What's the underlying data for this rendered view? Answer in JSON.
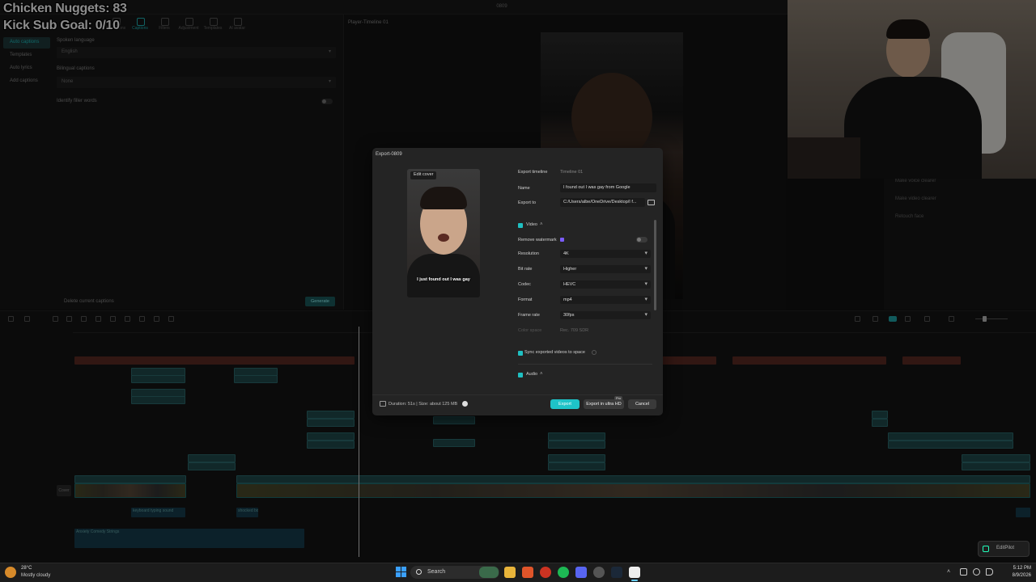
{
  "app": {
    "window_title": "0809"
  },
  "stream_overlay": {
    "line1": "Chicken Nuggets: 83",
    "line2": "Kick Sub Goal: 0/10"
  },
  "left_panel": {
    "toolbar_tabs": [
      "Transitions",
      "Captions",
      "Filters",
      "Adjustment",
      "Templates",
      "AI avatar"
    ],
    "side_menu": [
      "Auto captions",
      "Templates",
      "Auto lyrics",
      "Add captions"
    ],
    "spoken_language_label": "Spoken language",
    "spoken_language_value": "English",
    "bilingual_label": "Bilingual captions",
    "bilingual_value": "None",
    "identify_filler_label": "Identify filler words",
    "delete_captions": "Delete current captions",
    "generate_btn": "Generate"
  },
  "player": {
    "title": "Player-Timeline 01"
  },
  "right_panel": {
    "items": [
      "Make voice clearer",
      "Make video clearer",
      "Retouch face"
    ]
  },
  "modal": {
    "title": "Export-0809",
    "edit_cover": "Edit cover",
    "cover_caption": "I just found out I was gay",
    "export_timeline_label": "Export timeline",
    "export_timeline_value": "Timeline 01",
    "name_label": "Name",
    "name_value": "I found out I was gay from Google",
    "export_to_label": "Export to",
    "export_to_value": "C:/Users/albe/OneDrive/Desktop/I f...",
    "video_section": "Video",
    "remove_watermark_label": "Remove watermark",
    "resolution_label": "Resolution",
    "resolution_value": "4K",
    "bitrate_label": "Bit rate",
    "bitrate_value": "Higher",
    "codec_label": "Codec",
    "codec_value": "HEVC",
    "format_label": "Format",
    "format_value": "mp4",
    "framerate_label": "Frame rate",
    "framerate_value": "30fps",
    "colorspace_label": "Color space",
    "colorspace_value": "Rec. 709 SDR",
    "sync_label": "Sync exported videos to space",
    "audio_section": "Audio",
    "duration_text": "Duration: 51s | Size: about 125 MB",
    "export_btn": "Export",
    "ultra_btn": "Export in ultra HD",
    "pro_badge": "Pro",
    "cancel_btn": "Cancel"
  },
  "timeline": {
    "music_label": "Anxiety Comedy Strings",
    "audio_label1": "keyboard typing sound",
    "audio_label2": "shocked boy",
    "cover_label": "Cover"
  },
  "taskbar": {
    "temp": "28°C",
    "weather": "Mostly cloudy",
    "search": "Search",
    "time": "5:12 PM",
    "date": "8/9/2026",
    "editpilot": "EditPilot"
  },
  "colors": {
    "accent": "#1ec3c8",
    "caption_clip": "#5c2a24",
    "text_clip": "#1f4a4b"
  }
}
